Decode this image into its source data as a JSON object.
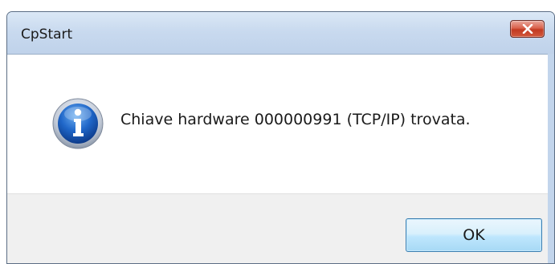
{
  "window": {
    "title": "CpStart",
    "close_icon": "close-icon"
  },
  "dialog": {
    "icon": "info-icon",
    "message": "Chiave hardware 000000991 (TCP/IP) trovata.",
    "ok_label": "OK"
  },
  "colors": {
    "titlebar": "#c9daef",
    "close_button": "#c23a22",
    "button_area": "#f0f0f0",
    "ok_button_border": "#3c7fb1",
    "info_icon": "#1f5fbf"
  }
}
